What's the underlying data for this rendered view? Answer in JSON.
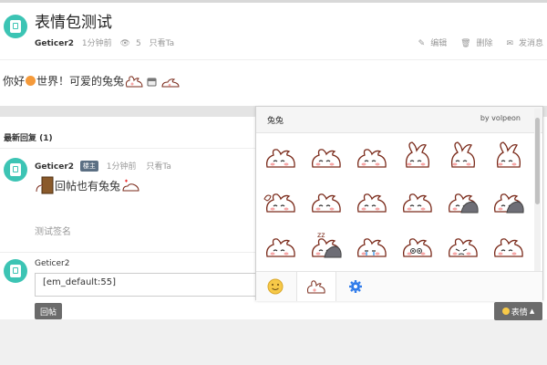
{
  "post": {
    "title": "表情包测试",
    "author": "Geticer2",
    "time": "1分钟前",
    "views": "5",
    "only_view": "只看Ta",
    "actions": [
      "编辑",
      "删除",
      "发消息"
    ],
    "body_text_1": "你好",
    "body_text_2": "世界！可爱的兔兔"
  },
  "replies": {
    "header": "最新回复 (1)",
    "items": [
      {
        "author": "Geticer2",
        "badge": "楼主",
        "time": "1分钟前",
        "only_view": "只看Ta",
        "text": "回帖也有兔兔",
        "signature": "测试签名"
      }
    ]
  },
  "reply_form": {
    "user": "Geticer2",
    "input_value": "[em_default:55]",
    "submit_label": "回帖",
    "emoji_button_label": "表情"
  },
  "emoji_panel": {
    "title": "兔兔",
    "credit": "by volpeon",
    "icons": [
      "rabbit-sleepy",
      "rabbit-wide-eyes",
      "rabbit-happy",
      "rabbit-squint",
      "rabbit-blush",
      "rabbit-grin",
      "rabbit-wave",
      "rabbit-smile",
      "rabbit-content",
      "rabbit-peek",
      "rabbit-blanket",
      "rabbit-cozy",
      "rabbit-tired",
      "rabbit-sleeping",
      "rabbit-crying",
      "rabbit-stare",
      "rabbit-angry",
      "rabbit-cheerful"
    ],
    "tabs": [
      "smiley-tab-icon",
      "rabbit-tab-icon",
      "gear-tab-icon"
    ],
    "colors": {
      "rabbit_fill": "#ffffff",
      "rabbit_outline": "#7a2a1a",
      "blush": "#f7a6a6",
      "blanket": "#6e6e76",
      "settings": "#2f7bea"
    }
  }
}
